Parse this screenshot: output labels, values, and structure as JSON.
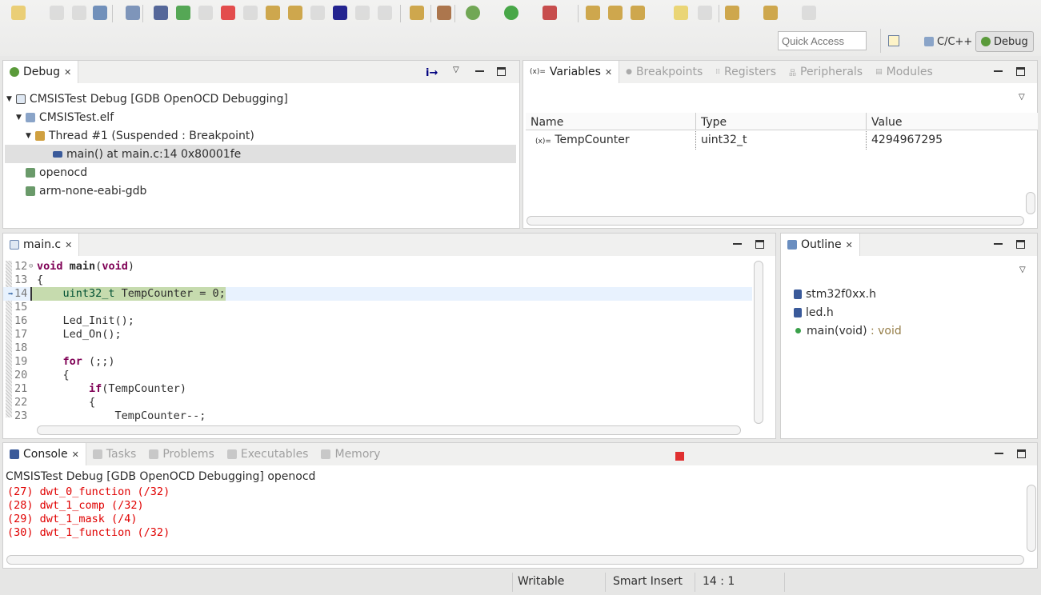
{
  "toolbar": {
    "quick_access_placeholder": "Quick Access",
    "perspectives": [
      {
        "label": "C/C++",
        "active": false
      },
      {
        "label": "Debug",
        "active": true
      }
    ],
    "icons": [
      "new-icon",
      "save-icon",
      "save-all-icon",
      "print-icon",
      "disassembly-icon",
      "skip-breakpoints-icon",
      "resume-icon",
      "suspend-icon",
      "terminate-icon",
      "disconnect-icon",
      "step-into-icon",
      "step-over-icon",
      "step-return-icon",
      "instruction-step-icon",
      "drop-to-frame-icon",
      "use-step-filters-icon",
      "restart-icon",
      "build-icon",
      "debug-icon",
      "run-icon",
      "external-tools-icon",
      "open-folder-icon",
      "open-type-icon",
      "search-icon",
      "highlight-icon",
      "next-annotation-icon",
      "prev-annotation-icon",
      "back-icon",
      "forward-icon"
    ]
  },
  "debug_view": {
    "tab": "Debug",
    "items": [
      {
        "label": "CMSISTest Debug [GDB OpenOCD Debugging]",
        "level": 0
      },
      {
        "label": "CMSISTest.elf",
        "level": 1
      },
      {
        "label": "Thread #1 (Suspended : Breakpoint)",
        "level": 2
      },
      {
        "label": "main() at main.c:14 0x80001fe",
        "level": 3,
        "selected": true
      },
      {
        "label": "openocd",
        "level": 1
      },
      {
        "label": "arm-none-eabi-gdb",
        "level": 1
      }
    ]
  },
  "variables_view": {
    "tabs": [
      "Variables",
      "Breakpoints",
      "Registers",
      "Peripherals",
      "Modules"
    ],
    "columns": [
      "Name",
      "Type",
      "Value"
    ],
    "rows": [
      {
        "name": "TempCounter",
        "type": "uint32_t",
        "value": "4294967295"
      }
    ]
  },
  "editor": {
    "tab": "main.c",
    "current_line": 14,
    "lines": [
      {
        "n": "12",
        "html": "<span class='kw'>void</span> <b>main</b>(<span class='kw'>void</span>)"
      },
      {
        "n": "13",
        "html": "{"
      },
      {
        "n": "14",
        "html": "    <span class='ty'>uint32_t</span> TempCounter = 0;"
      },
      {
        "n": "15",
        "html": ""
      },
      {
        "n": "16",
        "html": "    Led_Init();"
      },
      {
        "n": "17",
        "html": "    Led_On();"
      },
      {
        "n": "18",
        "html": ""
      },
      {
        "n": "19",
        "html": "    <span class='kw'>for</span> (;;)"
      },
      {
        "n": "20",
        "html": "    {"
      },
      {
        "n": "21",
        "html": "        <span class='kw'>if</span>(TempCounter)"
      },
      {
        "n": "22",
        "html": "        {"
      },
      {
        "n": "23",
        "html": "            TempCounter--;"
      }
    ]
  },
  "outline": {
    "tab": "Outline",
    "items": [
      {
        "label": "stm32f0xx.h",
        "type": ""
      },
      {
        "label": "led.h",
        "type": ""
      },
      {
        "label": "main(void)",
        "type": " : void"
      }
    ]
  },
  "console": {
    "tabs": [
      "Console",
      "Tasks",
      "Problems",
      "Executables",
      "Memory"
    ],
    "title": "CMSISTest Debug [GDB OpenOCD Debugging] openocd",
    "lines": [
      "(27) dwt_0_function (/32)",
      "(28) dwt_1_comp (/32)",
      "(29) dwt_1_mask (/4)",
      "(30) dwt_1_function (/32)"
    ],
    "text_color": "#e00000"
  },
  "status": {
    "writable": "Writable",
    "insert_mode": "Smart Insert",
    "position": "14 : 1"
  }
}
